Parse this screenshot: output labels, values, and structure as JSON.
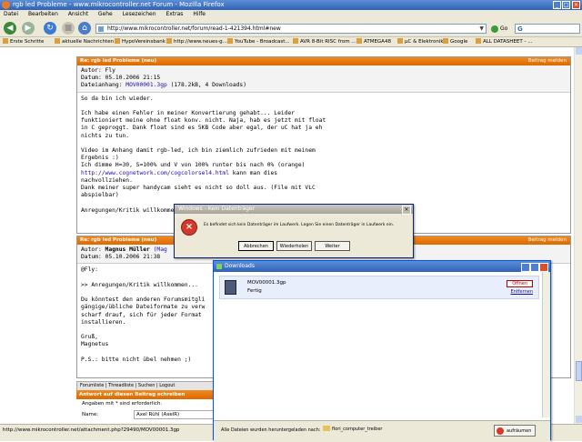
{
  "window": {
    "title": "rgb led Probleme - www.mikrocontroller.net Forum - Mozilla Firefox"
  },
  "menu": [
    "Datei",
    "Bearbeiten",
    "Ansicht",
    "Gehe",
    "Lesezeichen",
    "Extras",
    "Hilfe"
  ],
  "nav": {
    "url": "http://www.mikrocontroller.net/forum/read-1-421394.html#new",
    "go_label": "Go"
  },
  "bookmarks": [
    "Erste Schritte",
    "aktuelle Nachrichten ...",
    "HypoVereinsbank",
    "http://www.neues-g...",
    "YouTube - Broadcast...",
    "AVR 8-Bit RISC from ...",
    "ATMEGA48",
    "µC & Elektronik",
    "Google",
    "ALL DATASHEET - ..."
  ],
  "post1": {
    "header": "Re: rgb led Probleme (neu)",
    "reply_link": "Beitrag melden",
    "author_line": "Autor: Fly",
    "date_line": "Datum: 05.10.2006 21:15",
    "attach_label": "Dateianhang: ",
    "attach_link": "MOV00001.3gp",
    "attach_info": " (178.2kB, 4 Downloads)",
    "body_a": "So da bin ich wieder.\n\nIch habe einen Fehler in meiner Konvertierung gehabt... Leider\nfunktioniert meine ohne float konv. nicht. Naja, hab es jetzt mit float\nin C geproggt. Dank float sind es 5KB Code aber egal, der uC hat ja eh\nnichts zu tun.\n\nVideo im Anhang damit rgb-led, ich bin ziemlich zufrieden mit meinem\nErgebnis :)\nIch dimme H=30, S=100% und V von 100% runter bis nach 0% (orange)",
    "link": "http://www.cognetwork.com/cogcolorsel4.html",
    "link_tail": " kann man dies",
    "body_b": "nachvollziehen.\nDank meiner super handycam sieht es nicht so doll aus. (File mit VLC\nabspielbar)\n\nAnregungen/Kritik willkommen..."
  },
  "post2": {
    "header": "Re: rgb led Probleme (neu)",
    "reply_link": "Beitrag melden",
    "author_label": "Autor: ",
    "author_name": "Magnus Müller",
    "author_link": "(Mag",
    "date_line": "Datum: 05.10.2006 21:38",
    "body": "@Fly:\n\n>> Anregungen/Kritik willkommen...\n\nDu könntest den anderen Forumsmitgli\ngängige/übliche Dateiformate zu verw\nscharf drauf, sich für jeder Format\ninstallieren.\n\nGruß,\nMagnetus\n\nP.S.: bitte nicht übel nehmen ;)"
  },
  "bottom": {
    "links": "Forumliste | Threadliste | Suchen | Logout",
    "answer_header": "Antwort auf diesen Beitrag schreiben",
    "required": "Angaben mit * sind erforderlich.",
    "name_label": "Name:",
    "name_value": "Axel Rühl (AxelR)"
  },
  "status": {
    "text": "http://www.mikrocontroller.net/attachment.php?29490/MOV00001.3gp"
  },
  "dialog": {
    "title": "Windows - Kein Datenträger",
    "message": "Es befindet sich kein Datenträger im Laufwerk. Legen Sie einen Datenträger in Laufwerk ein.",
    "buttons": [
      "Abbrechen",
      "Wiederholen",
      "Weiter"
    ]
  },
  "downloads": {
    "title": "Downloads",
    "file": "MOV00001.3gp",
    "file_status": "Fertig",
    "open_label": "Öffnen",
    "remove_label": "Entfernen",
    "saved_label": "Alle Dateien wurden heruntergeladen nach:",
    "folder": "flori_computer_treiber",
    "cleanup_label": "aufräumen"
  },
  "colors": {
    "accent": "#e07800",
    "titlebar": "#2f62b8",
    "chrome": "#ece9d8"
  }
}
